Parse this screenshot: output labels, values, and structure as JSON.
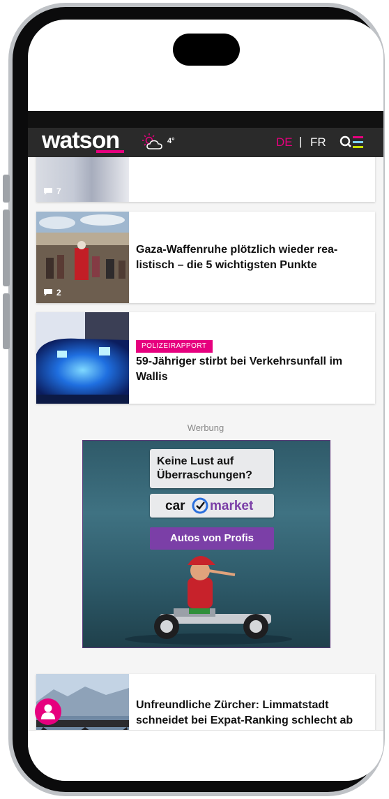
{
  "header": {
    "logo": "watson",
    "temperature": "4°",
    "weather_icon": "sun-cloud-icon",
    "lang_de": "DE",
    "lang_sep": "|",
    "lang_fr": "FR",
    "active_language": "DE",
    "menu_icon": "search-menu-icon"
  },
  "articles": [
    {
      "title": "",
      "comments": "7"
    },
    {
      "title": "Gaza-Waffenruhe plötzlich wieder rea-listisch – die 5 wichtigsten Punkte",
      "comments": "2"
    },
    {
      "tag": "POLIZEIRAPPORT",
      "title": "59-Jähriger stirbt bei Verkehrsunfall im Wallis"
    },
    {
      "title": "Unfreundliche Zürcher: Limmatstadt schneidet bei Expat-Ranking schlecht ab"
    }
  ],
  "ad": {
    "label": "Werbung",
    "headline": "Keine Lust auf Überraschungen?",
    "brand": "car market",
    "cta": "Autos von Profis"
  },
  "colors": {
    "brand": "#e6007e",
    "header_bg": "#2a2a2a",
    "ad_cta": "#7b3fa7"
  }
}
